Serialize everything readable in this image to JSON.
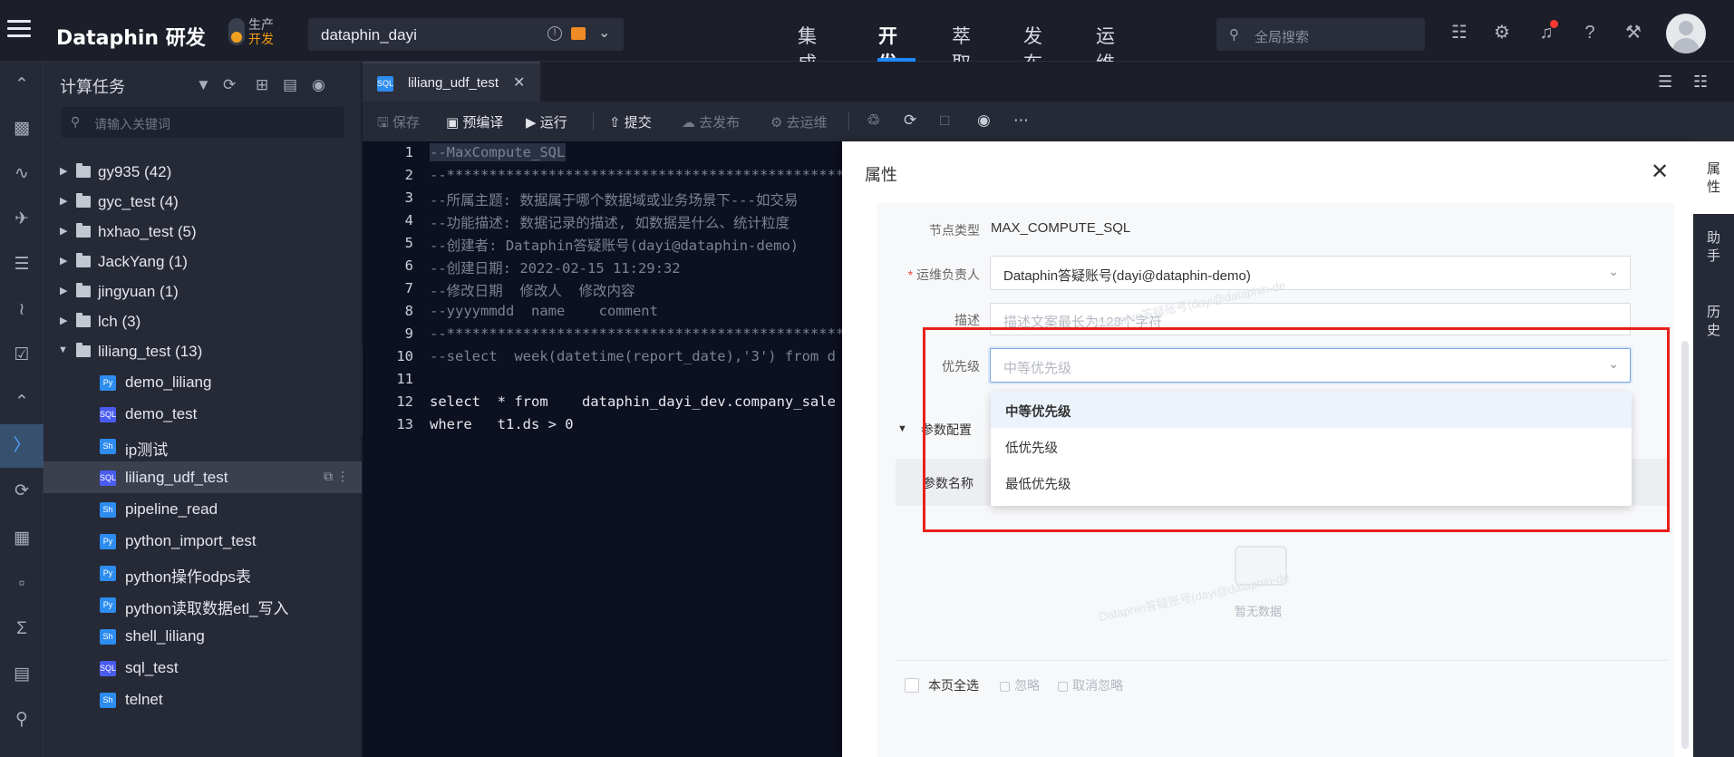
{
  "brand": "Dataphin 研发",
  "env": {
    "prod": "生产",
    "dev": "开发"
  },
  "project": {
    "name": "dataphin_dayi"
  },
  "nav": {
    "items": [
      "集成",
      "开发",
      "萃取",
      "发布",
      "运维"
    ],
    "active": "开发"
  },
  "global_search": {
    "placeholder": "全局搜索"
  },
  "tree_panel": {
    "title": "计算任务",
    "search_placeholder": "请输入关键词",
    "folders": [
      {
        "label": "gy935 (42)"
      },
      {
        "label": "gyc_test (4)"
      },
      {
        "label": "hxhao_test (5)"
      },
      {
        "label": "JackYang (1)"
      },
      {
        "label": "jingyuan (1)"
      },
      {
        "label": "lch (3)"
      },
      {
        "label": "liliang_test (13)"
      }
    ],
    "files": [
      {
        "label": "demo_liliang",
        "type": "Py"
      },
      {
        "label": "demo_test",
        "type": "SQL"
      },
      {
        "label": "ip测试",
        "type": "Sh"
      },
      {
        "label": "liliang_udf_test",
        "type": "SQL"
      },
      {
        "label": "pipeline_read",
        "type": "Sh"
      },
      {
        "label": "python_import_test",
        "type": "Py"
      },
      {
        "label": "python操作odps表",
        "type": "Py"
      },
      {
        "label": "python读取数据etl_写入",
        "type": "Py"
      },
      {
        "label": "shell_liliang",
        "type": "Sh"
      },
      {
        "label": "sql_test",
        "type": "SQL"
      },
      {
        "label": "telnet",
        "type": "Sh"
      }
    ]
  },
  "tab": {
    "label": "liliang_udf_test",
    "badge": "SQL"
  },
  "toolbar": {
    "save": "保存",
    "precompile": "预编译",
    "run": "运行",
    "submit": "提交",
    "publish": "去发布",
    "ops": "去运维"
  },
  "editor": {
    "lines": [
      "--MaxCompute_SQL",
      "--**********************************************************************",
      "--所属主题: 数据属于哪个数据域或业务场景下---如交易",
      "--功能描述: 数据记录的描述, 如数据是什么、统计粒度",
      "--创建者: Dataphin答疑账号(dayi@dataphin-demo)",
      "--创建日期: 2022-02-15 11:29:32",
      "--修改日期  修改人  修改内容",
      "--yyyymmdd  name    comment",
      "--**********************************************************************",
      "--select  week(datetime(report_date),'3') from d",
      "",
      "select  * from    dataphin_dayi_dev.company_sale",
      "where   t1.ds > 0"
    ],
    "line_numbers": [
      "1",
      "2",
      "3",
      "4",
      "5",
      "6",
      "7",
      "8",
      "9",
      "10",
      "11",
      "12",
      "13"
    ]
  },
  "props": {
    "title": "属性",
    "node_type_label": "节点类型",
    "node_type_value": "MAX_COMPUTE_SQL",
    "owner_label": "运维负责人",
    "owner_value": "Dataphin答疑账号(dayi@dataphin-demo)",
    "desc_label": "描述",
    "desc_placeholder": "描述文案最长为128个字符",
    "priority_label": "优先级",
    "priority_value": "中等优先级",
    "priority_options": [
      "中等优先级",
      "低优先级",
      "最低优先级"
    ],
    "param_section": "参数配置",
    "param_name_col": "参数名称",
    "empty_text": "暂无数据",
    "select_all": "本页全选",
    "ignore": "忽略",
    "unignore": "取消忽略",
    "watermark": "Dataphin答疑账号(dayi@dataphin-de"
  },
  "right_strip": [
    "属\n性",
    "助\n手",
    "历\n史"
  ],
  "colors": {
    "accent": "#1e88ff",
    "highlight_box": "#e8201a",
    "env_dev": "#f39c12"
  }
}
